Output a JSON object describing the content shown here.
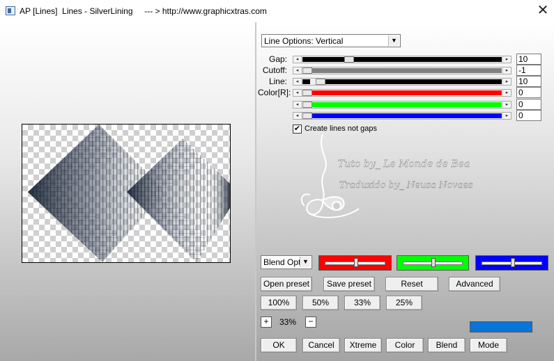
{
  "window": {
    "title": "AP [Lines]  Lines - SilverLining     --- > http://www.graphicxtras.com",
    "close_glyph": "✕"
  },
  "line_options": {
    "selected": "Line Options: Vertical"
  },
  "sliders": [
    {
      "label": "Gap:",
      "value": "10",
      "fill": "#000000",
      "position": 0.22
    },
    {
      "label": "Cutoff:",
      "value": "-1",
      "fill": "#808080",
      "position": 0.0
    },
    {
      "label": "Line:",
      "value": "10",
      "fill": "#000000",
      "position": 0.04
    },
    {
      "label": "Color[R]:",
      "value": "0",
      "fill": "#ff0000",
      "position": 0.0
    },
    {
      "label": "",
      "value": "0",
      "fill": "#00ff00",
      "position": 0.0
    },
    {
      "label": "",
      "value": "0",
      "fill": "#0000ff",
      "position": 0.0
    }
  ],
  "checkbox": {
    "label": "Create lines not gaps",
    "checked": true
  },
  "watermark": {
    "line1": "Tuto by_ Le Monde de Bea",
    "line2": "Traduzido by_ Neusa Novaes"
  },
  "blend": {
    "dropdown": "Blend Optio",
    "colors": [
      {
        "bg": "#ff0000",
        "position": 0.5
      },
      {
        "bg": "#00ff00",
        "position": 0.5
      },
      {
        "bg": "#0000ff",
        "position": 0.5
      }
    ]
  },
  "buttons": {
    "open_preset": "Open preset",
    "save_preset": "Save preset",
    "reset": "Reset",
    "advanced": "Advanced",
    "z100": "100%",
    "z50": "50%",
    "z33": "33%",
    "z25": "25%",
    "ok": "OK",
    "cancel": "Cancel",
    "xtreme": "Xtreme",
    "color": "Color",
    "blend": "Blend",
    "mode": "Mode"
  },
  "zoom": {
    "plus": "+",
    "value": "33%",
    "minus": "−"
  },
  "accent_color": "#0a74d9"
}
